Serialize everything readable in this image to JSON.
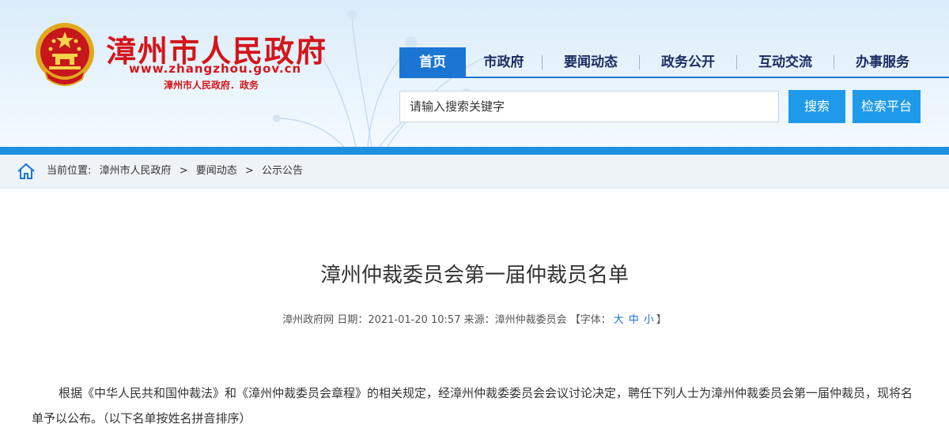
{
  "header": {
    "site_name": "漳州市人民政府",
    "site_url": "www.zhangzhou.gov.cn",
    "site_sub": "漳州市人民政府．政务"
  },
  "nav": {
    "items": [
      {
        "label": "首页",
        "active": true
      },
      {
        "label": "市政府"
      },
      {
        "label": "要闻动态"
      },
      {
        "label": "政务公开"
      },
      {
        "label": "互动交流"
      },
      {
        "label": "办事服务"
      }
    ]
  },
  "search": {
    "placeholder": "请输入搜索关键字",
    "search_label": "搜索",
    "platform_label": "检索平台"
  },
  "breadcrumb": {
    "prefix": "当前位置:",
    "items": [
      "漳州市人民政府",
      "要闻动态",
      "公示公告"
    ],
    "separator": ">"
  },
  "article": {
    "title": "漳州仲裁委员会第一届仲裁员名单",
    "meta_source_site": "漳州政府网",
    "meta_date": "日期：2021-01-20 10:57",
    "meta_origin": "来源：漳州仲裁委员会",
    "font_open": "【字体：",
    "font_large": "大",
    "font_medium": "中",
    "font_small": "小",
    "font_close": "】",
    "paragraph": "根据《中华人民共和国仲裁法》和《漳州仲裁委员会章程》的相关规定，经漳州仲裁委委员会会议讨论决定，聘任下列人士为漳州仲裁委员会第一届仲裁员，现将名单予以公布。（以下名单按姓名拼音排序）"
  },
  "colors": {
    "brand_red": "#d4151a",
    "nav_blue": "#1a76d2",
    "button_blue": "#1f9aea"
  },
  "icons": [
    "national-emblem-icon",
    "home-icon"
  ]
}
